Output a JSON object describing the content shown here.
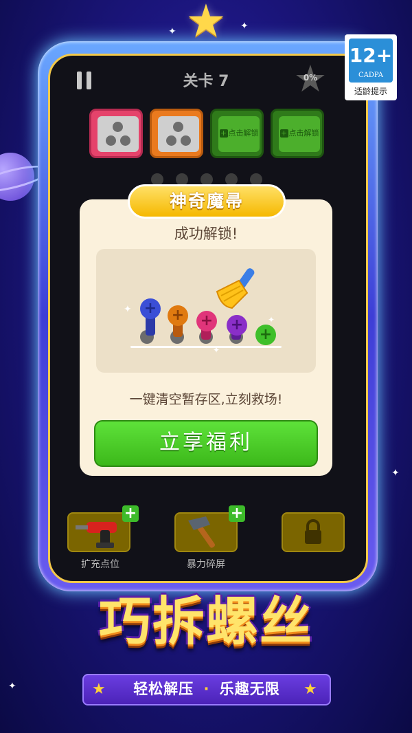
{
  "hud": {
    "level": "关卡 7",
    "progress": "0%"
  },
  "slots": [
    {
      "state": "open",
      "color": "#e5436b"
    },
    {
      "state": "open",
      "color": "#ea7a1e"
    },
    {
      "state": "locked",
      "label": "点击解锁"
    },
    {
      "state": "locked",
      "label": "点击解锁"
    }
  ],
  "modal": {
    "title": "神奇魔帚",
    "message": "成功解锁!",
    "description": "一键清空暂存区,立刻救场!",
    "button_label": "立享福利"
  },
  "tools": [
    {
      "label": "扩充点位",
      "icon": "drill-icon"
    },
    {
      "label": "暴力碎屏",
      "icon": "hammer-icon"
    },
    {
      "label": "",
      "icon": "lock-icon"
    }
  ],
  "branding": {
    "game_title": "巧拆螺丝",
    "tagline_left": "轻松解压",
    "tagline_right": "乐趣无限"
  },
  "age_rating": {
    "rating": "12+",
    "org": "CADPA",
    "tip": "适龄提示"
  },
  "screws": [
    {
      "color": "#3b4fd6"
    },
    {
      "color": "#e07a10"
    },
    {
      "color": "#e0357a"
    },
    {
      "color": "#8a2fc8"
    },
    {
      "color": "#3fbf2a"
    }
  ]
}
